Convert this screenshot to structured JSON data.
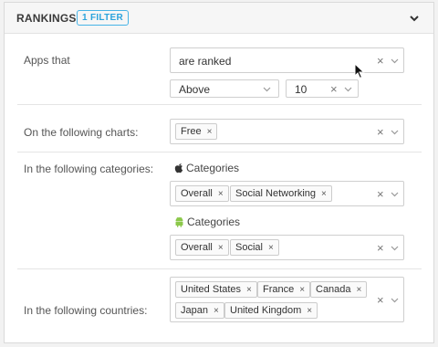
{
  "header": {
    "title": "RANKINGS",
    "badge": "1 FILTER"
  },
  "apps_that": {
    "label": "Apps that",
    "select_value": "are ranked",
    "position_value": "Above",
    "rank_value": "10"
  },
  "charts": {
    "label": "On the following charts:",
    "chips": [
      "Free"
    ]
  },
  "categories": {
    "label": "In the following categories:",
    "ios_label": "Categories",
    "ios_chips": [
      "Overall",
      "Social Networking"
    ],
    "android_label": "Categories",
    "android_chips": [
      "Overall",
      "Social"
    ]
  },
  "countries": {
    "label": "In the following countries:",
    "chips": [
      "United States",
      "France",
      "Canada",
      "Japan",
      "United Kingdom"
    ]
  },
  "icons": {
    "collapse": "chevron-down-icon",
    "clear": "close-icon",
    "dropdown": "chevron-down-icon",
    "ios": "apple-icon",
    "android": "android-icon"
  },
  "colors": {
    "accent": "#2aa3dc",
    "android": "#8cc84b"
  }
}
